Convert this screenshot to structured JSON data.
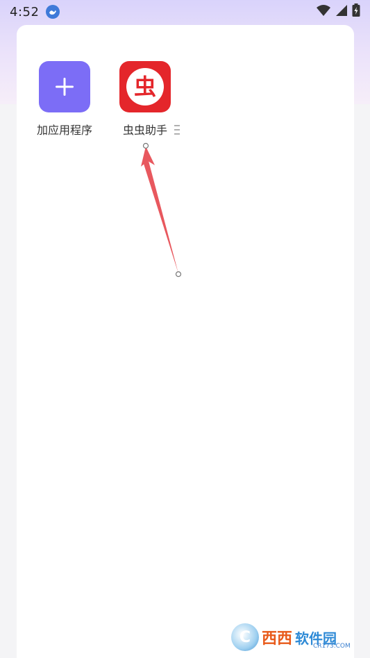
{
  "status_bar": {
    "time": "4:52",
    "icons": [
      "notification-app-icon",
      "wifi-icon",
      "cell-signal-icon",
      "battery-charging-icon"
    ]
  },
  "apps": [
    {
      "label": "加应用程序",
      "icon": "plus-icon",
      "color": "#7c6df6"
    },
    {
      "label": "虫虫助手",
      "icon": "chong-logo-icon",
      "logo_text": "虫",
      "color": "#e4262b"
    }
  ],
  "annotation": {
    "type": "arrow",
    "color": "#e8585e"
  },
  "watermark": {
    "logo": "C",
    "text": "西西",
    "text2": "软件园",
    "sub": "CR173.COM"
  }
}
